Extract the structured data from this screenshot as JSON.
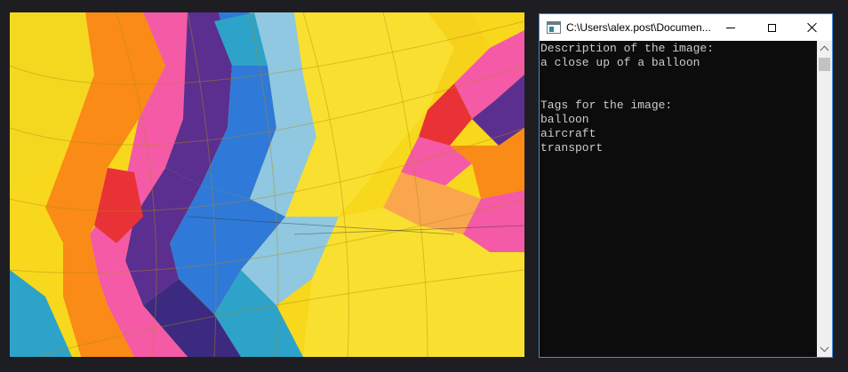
{
  "photo": {
    "subject": "hot-air-balloon-interior",
    "colors": {
      "yellow": "#f7d81c",
      "orange": "#f98b16",
      "pink": "#f45aa6",
      "purple": "#5a2f8f",
      "blue": "#2f79d8",
      "lightblue": "#8fc8e0",
      "teal": "#2ea3c9",
      "red": "#e83236"
    }
  },
  "console": {
    "title": "C:\\Users\\alex.post\\Documen...",
    "icon": "console-app-icon",
    "buttons": {
      "minimize": "minimize-icon",
      "maximize": "maximize-icon",
      "close": "close-icon"
    },
    "lines": [
      "Description of the image:",
      "a close up of a balloon",
      "",
      "",
      "Tags for the image:",
      "balloon",
      "aircraft",
      "transport"
    ],
    "colors": {
      "background": "#0c0c0c",
      "text": "#cccccc",
      "border": "#3c8fd8"
    }
  }
}
